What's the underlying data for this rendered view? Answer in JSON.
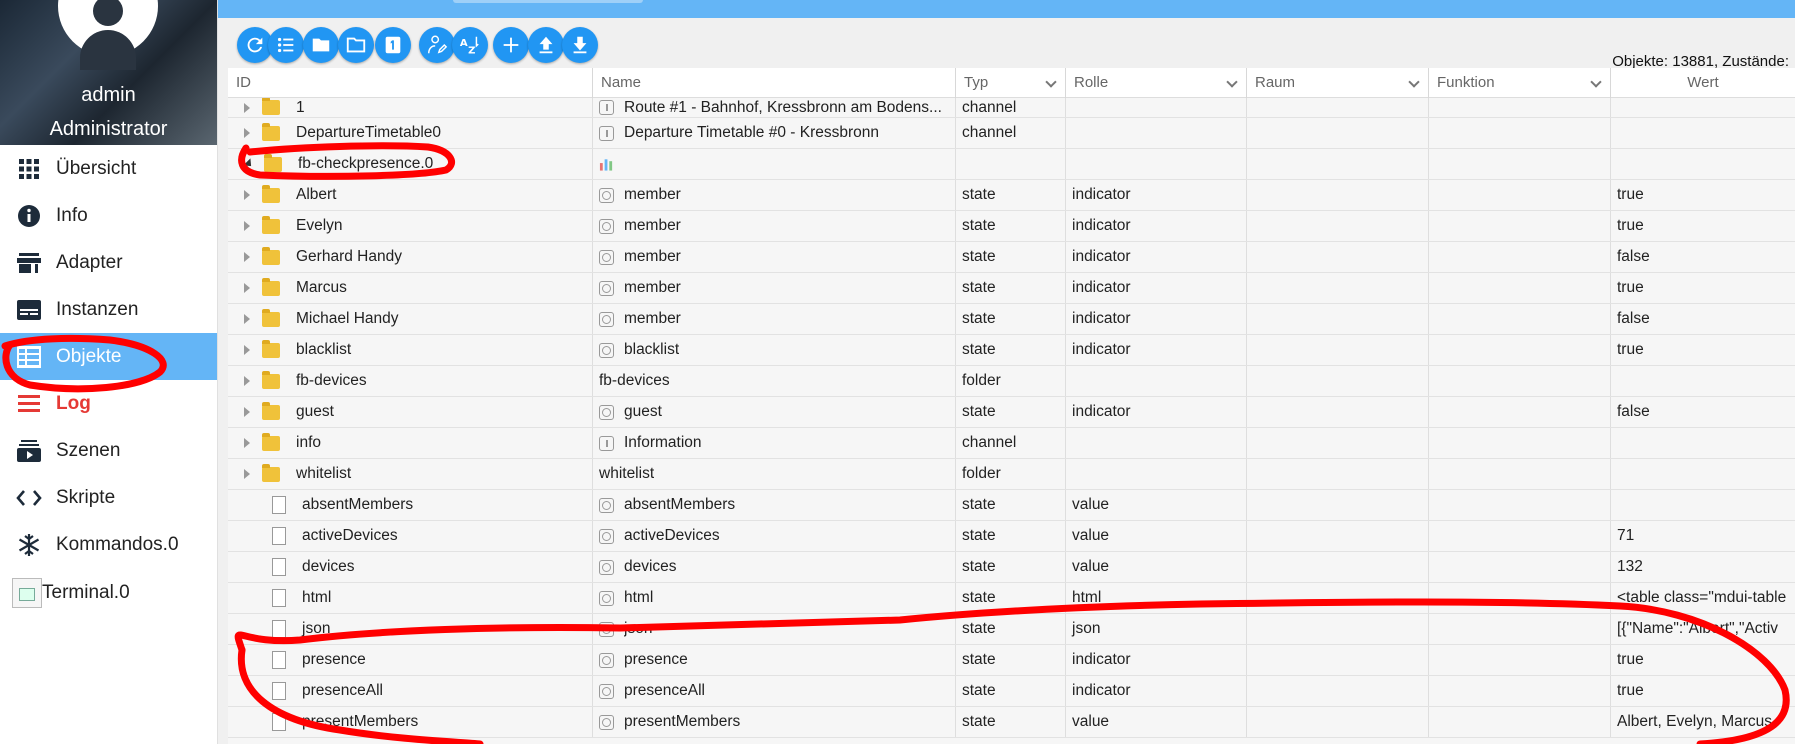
{
  "sidebar": {
    "user_name": "admin",
    "user_role": "Administrator",
    "items": [
      {
        "label": "Übersicht",
        "icon": "grid-icon"
      },
      {
        "label": "Info",
        "icon": "info-icon"
      },
      {
        "label": "Adapter",
        "icon": "store-icon"
      },
      {
        "label": "Instanzen",
        "icon": "instances-icon"
      },
      {
        "label": "Objekte",
        "icon": "table-icon",
        "active": true
      },
      {
        "label": "Log",
        "icon": "log-icon"
      },
      {
        "label": "Szenen",
        "icon": "scenes-icon"
      },
      {
        "label": "Skripte",
        "icon": "code-icon"
      },
      {
        "label": "Kommandos.0",
        "icon": "snowflake-icon"
      },
      {
        "label": "Terminal.0",
        "icon": "broken-image-icon"
      }
    ]
  },
  "toolbar": {
    "buttons": [
      "refresh-icon",
      "list-icon",
      "folder-icon",
      "folder-outline-icon",
      "number-one-icon",
      "person-edit-icon",
      "sort-az-icon",
      "add-icon",
      "upload-icon",
      "download-icon"
    ],
    "object_count": "Objekte: 13881, Zustände:"
  },
  "table": {
    "headers": {
      "id": "ID",
      "name": "Name",
      "typ": "Typ",
      "rolle": "Rolle",
      "raum": "Raum",
      "funktion": "Funktion",
      "wert": "Wert"
    },
    "rows": [
      {
        "id": "1",
        "icon": "folder",
        "expand": "closed",
        "name": "Route #1 - Bahnhof, Kressbronn am Bodens...",
        "name_icon": "channel",
        "typ": "channel",
        "rolle": "",
        "wert": ""
      },
      {
        "id": "DepartureTimetable0",
        "icon": "folder",
        "expand": "closed",
        "name": "Departure Timetable #0 - Kressbronn",
        "name_icon": "channel",
        "typ": "channel",
        "rolle": "",
        "wert": ""
      },
      {
        "id": "fb-checkpresence.0",
        "icon": "folder",
        "expand": "open",
        "name": "",
        "name_icon": "adapter",
        "typ": "",
        "rolle": "",
        "wert": ""
      },
      {
        "id": "Albert",
        "icon": "folder",
        "expand": "closed",
        "name": "member",
        "name_icon": "state",
        "typ": "state",
        "rolle": "indicator",
        "wert": "true"
      },
      {
        "id": "Evelyn",
        "icon": "folder",
        "expand": "closed",
        "name": "member",
        "name_icon": "state",
        "typ": "state",
        "rolle": "indicator",
        "wert": "true"
      },
      {
        "id": "Gerhard Handy",
        "icon": "folder",
        "expand": "closed",
        "name": "member",
        "name_icon": "state",
        "typ": "state",
        "rolle": "indicator",
        "wert": "false"
      },
      {
        "id": "Marcus",
        "icon": "folder",
        "expand": "closed",
        "name": "member",
        "name_icon": "state",
        "typ": "state",
        "rolle": "indicator",
        "wert": "true"
      },
      {
        "id": "Michael Handy",
        "icon": "folder",
        "expand": "closed",
        "name": "member",
        "name_icon": "state",
        "typ": "state",
        "rolle": "indicator",
        "wert": "false"
      },
      {
        "id": "blacklist",
        "icon": "folder",
        "expand": "closed",
        "name": "blacklist",
        "name_icon": "state",
        "typ": "state",
        "rolle": "indicator",
        "wert": "true"
      },
      {
        "id": "fb-devices",
        "icon": "folder",
        "expand": "closed",
        "name": "fb-devices",
        "name_icon": "",
        "typ": "folder",
        "rolle": "",
        "wert": ""
      },
      {
        "id": "guest",
        "icon": "folder",
        "expand": "closed",
        "name": "guest",
        "name_icon": "state",
        "typ": "state",
        "rolle": "indicator",
        "wert": "false"
      },
      {
        "id": "info",
        "icon": "folder",
        "expand": "closed",
        "name": "Information",
        "name_icon": "channel",
        "typ": "channel",
        "rolle": "",
        "wert": ""
      },
      {
        "id": "whitelist",
        "icon": "folder",
        "expand": "closed",
        "name": "whitelist",
        "name_icon": "",
        "typ": "folder",
        "rolle": "",
        "wert": ""
      },
      {
        "id": "absentMembers",
        "icon": "doc",
        "expand": "",
        "name": "absentMembers",
        "name_icon": "state",
        "typ": "state",
        "rolle": "value",
        "wert": ""
      },
      {
        "id": "activeDevices",
        "icon": "doc",
        "expand": "",
        "name": "activeDevices",
        "name_icon": "state",
        "typ": "state",
        "rolle": "value",
        "wert": "71"
      },
      {
        "id": "devices",
        "icon": "doc",
        "expand": "",
        "name": "devices",
        "name_icon": "state",
        "typ": "state",
        "rolle": "value",
        "wert": "132"
      },
      {
        "id": "html",
        "icon": "doc",
        "expand": "",
        "name": "html",
        "name_icon": "state",
        "typ": "state",
        "rolle": "html",
        "wert": "<table class=\"mdui-table"
      },
      {
        "id": "json",
        "icon": "doc",
        "expand": "",
        "name": "json",
        "name_icon": "state",
        "typ": "state",
        "rolle": "json",
        "wert": "[{\"Name\":\"Albert\",\"Activ"
      },
      {
        "id": "presence",
        "icon": "doc",
        "expand": "",
        "name": "presence",
        "name_icon": "state",
        "typ": "state",
        "rolle": "indicator",
        "wert": "true"
      },
      {
        "id": "presenceAll",
        "icon": "doc",
        "expand": "",
        "name": "presenceAll",
        "name_icon": "state",
        "typ": "state",
        "rolle": "indicator",
        "wert": "true"
      },
      {
        "id": "presentMembers",
        "icon": "doc",
        "expand": "",
        "name": "presentMembers",
        "name_icon": "state",
        "typ": "state",
        "rolle": "value",
        "wert": "Albert, Evelyn, Marcus"
      }
    ]
  },
  "colors": {
    "accent": "#64b5f6",
    "button": "#2196f3",
    "log": "#e53935",
    "annotation": "#ff0000"
  }
}
